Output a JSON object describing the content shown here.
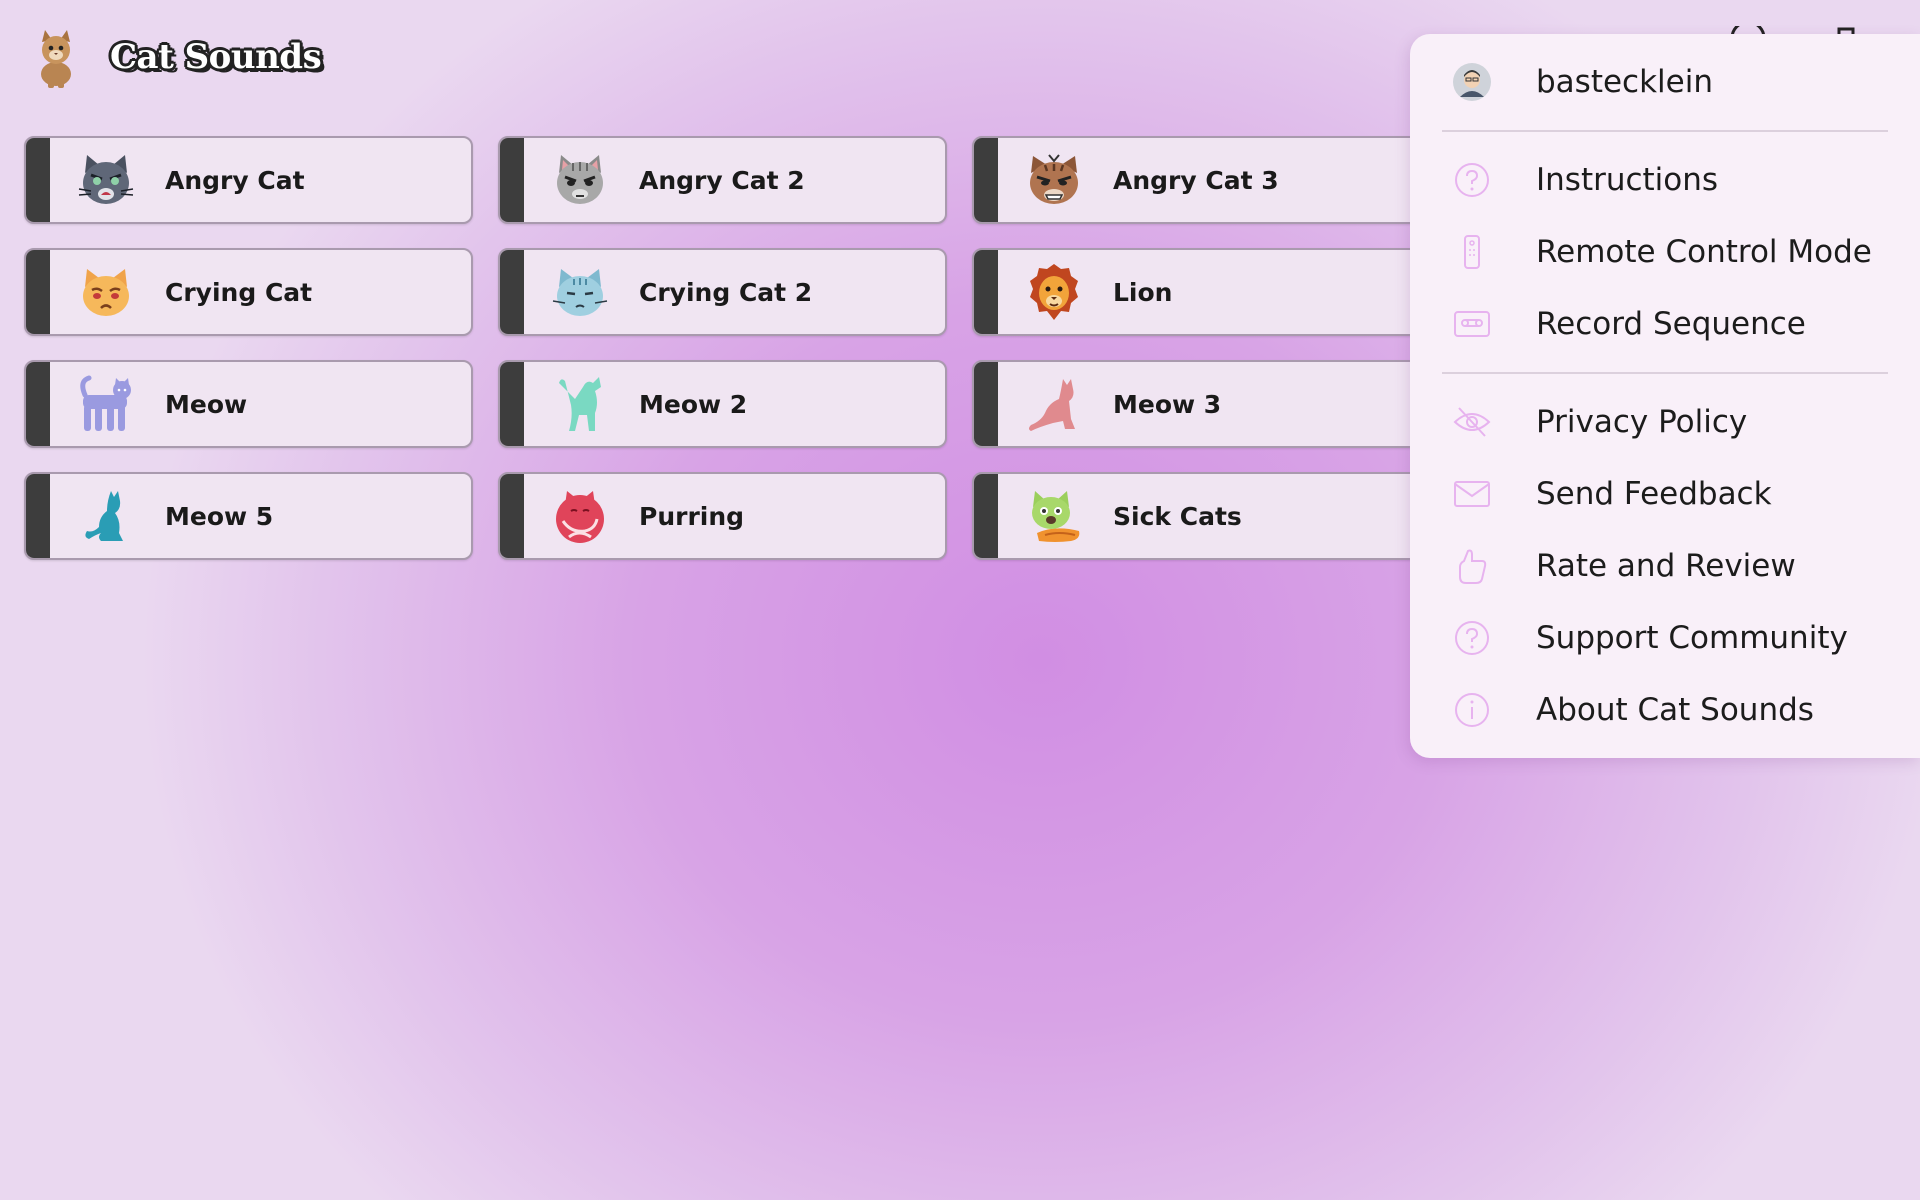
{
  "app": {
    "title": "Cat Sounds",
    "logo_icon": "cat-logo-icon"
  },
  "sounds": [
    {
      "label": "Angry Cat",
      "icon": "angry-cat-icon"
    },
    {
      "label": "Angry Cat 2",
      "icon": "angry-cat-2-icon"
    },
    {
      "label": "Angry Cat 3",
      "icon": "angry-cat-3-icon"
    },
    {
      "label": "Crying Cat",
      "icon": "crying-cat-icon"
    },
    {
      "label": "Crying Cat 2",
      "icon": "crying-cat-2-icon"
    },
    {
      "label": "Lion",
      "icon": "lion-icon"
    },
    {
      "label": "Meow",
      "icon": "meow-icon"
    },
    {
      "label": "Meow 2",
      "icon": "meow-2-icon"
    },
    {
      "label": "Meow 3",
      "icon": "meow-3-icon"
    },
    {
      "label": "Meow 5",
      "icon": "meow-5-icon"
    },
    {
      "label": "Purring",
      "icon": "purring-icon"
    },
    {
      "label": "Sick Cats",
      "icon": "sick-cats-icon"
    }
  ],
  "menu": {
    "user": {
      "name": "bastecklein",
      "icon": "avatar-icon"
    },
    "items": [
      {
        "label": "Instructions",
        "icon": "help-circle-icon"
      },
      {
        "label": "Remote Control Mode",
        "icon": "remote-icon"
      },
      {
        "label": "Record Sequence",
        "icon": "cassette-icon"
      },
      {
        "label": "Privacy Policy",
        "icon": "eye-off-icon"
      },
      {
        "label": "Send Feedback",
        "icon": "mail-icon"
      },
      {
        "label": "Rate and Review",
        "icon": "thumbs-up-icon"
      },
      {
        "label": "Support Community",
        "icon": "help-circle-icon"
      },
      {
        "label": "About Cat Sounds",
        "icon": "info-icon"
      }
    ]
  },
  "colors": {
    "button_bg": "#f0e5f2",
    "button_bar": "#3d3d3d",
    "menu_bg": "#f9f0f9",
    "menu_icon": "#e7b3ef"
  }
}
